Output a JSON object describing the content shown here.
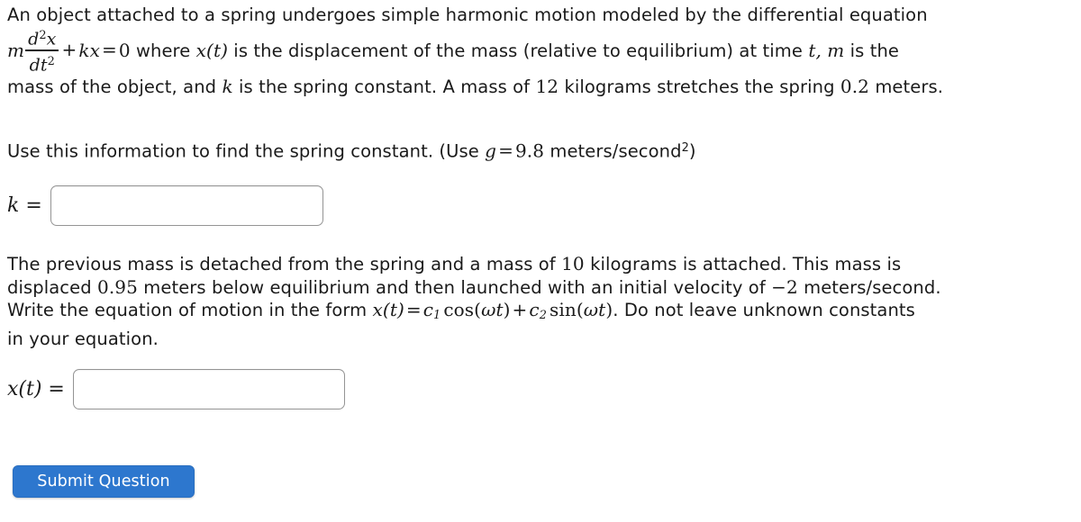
{
  "problem": {
    "intro": {
      "line1_pre": "An object attached to a spring undergoes simple harmonic motion modeled by the differential equation",
      "eq_m": "m",
      "eq_frac_num": "d",
      "eq_frac_num_sup": "2",
      "eq_frac_num_var": "x",
      "eq_frac_den": "dt",
      "eq_frac_den_sup": "2",
      "eq_plus": "+",
      "eq_kx": "kx",
      "eq_equals": "=",
      "eq_zero": "0",
      "line2_a": "where",
      "eq_xt": "x(t)",
      "line2_b": "is the displacement of the mass (relative to equilibrium) at time",
      "eq_t": "t,",
      "eq_m2": "m",
      "line2_c": "is the",
      "line3_a": "mass of the object, and",
      "eq_k": "k",
      "line3_b": "is the spring constant. A mass of",
      "mass1": "12",
      "line3_c": "kilograms stretches the spring",
      "stretch": "0.2",
      "line3_d": "meters."
    },
    "use_info": {
      "text_a": "Use this information to find the spring constant. (Use",
      "g_symbol": "g",
      "equals": "=",
      "g_value": "9.8",
      "units": "meters/second",
      "units_exp": "2",
      "close_paren": ")"
    },
    "answer_k": {
      "label_var": "k",
      "label_eq": "=",
      "value": "",
      "placeholder": ""
    },
    "second_part": {
      "line1_a": "The previous mass is detached from the spring and a mass of",
      "mass2": "10",
      "line1_b": "kilograms is attached. This mass is",
      "line2_a": "displaced",
      "displacement": "0.95",
      "line2_b": "meters below equilibrium and then launched with an initial velocity of",
      "velocity": "−2",
      "line2_c": "meters/second.",
      "line3_a": "Write the equation of motion in the form",
      "eq_xt": "x(t)",
      "eq_equals": "=",
      "eq_c1": "c",
      "eq_c1_sub": "1",
      "eq_cos": "cos",
      "eq_open": "(",
      "eq_omega": "ω",
      "eq_t": "t",
      "eq_close": ")",
      "eq_plus": "+",
      "eq_c2": "c",
      "eq_c2_sub": "2",
      "eq_sin": "sin",
      "line3_b": ". Do not leave unknown constants",
      "line4": "in your equation."
    },
    "answer_xt": {
      "label_var": "x(t)",
      "label_eq": "=",
      "value": "",
      "placeholder": ""
    }
  },
  "actions": {
    "submit_label": "Submit Question"
  },
  "colors": {
    "submit_button_bg": "#2d77ce",
    "submit_button_text": "#ffffff",
    "input_border": "#949494",
    "page_background": "#ffffff",
    "text": "#1a1a1a"
  }
}
